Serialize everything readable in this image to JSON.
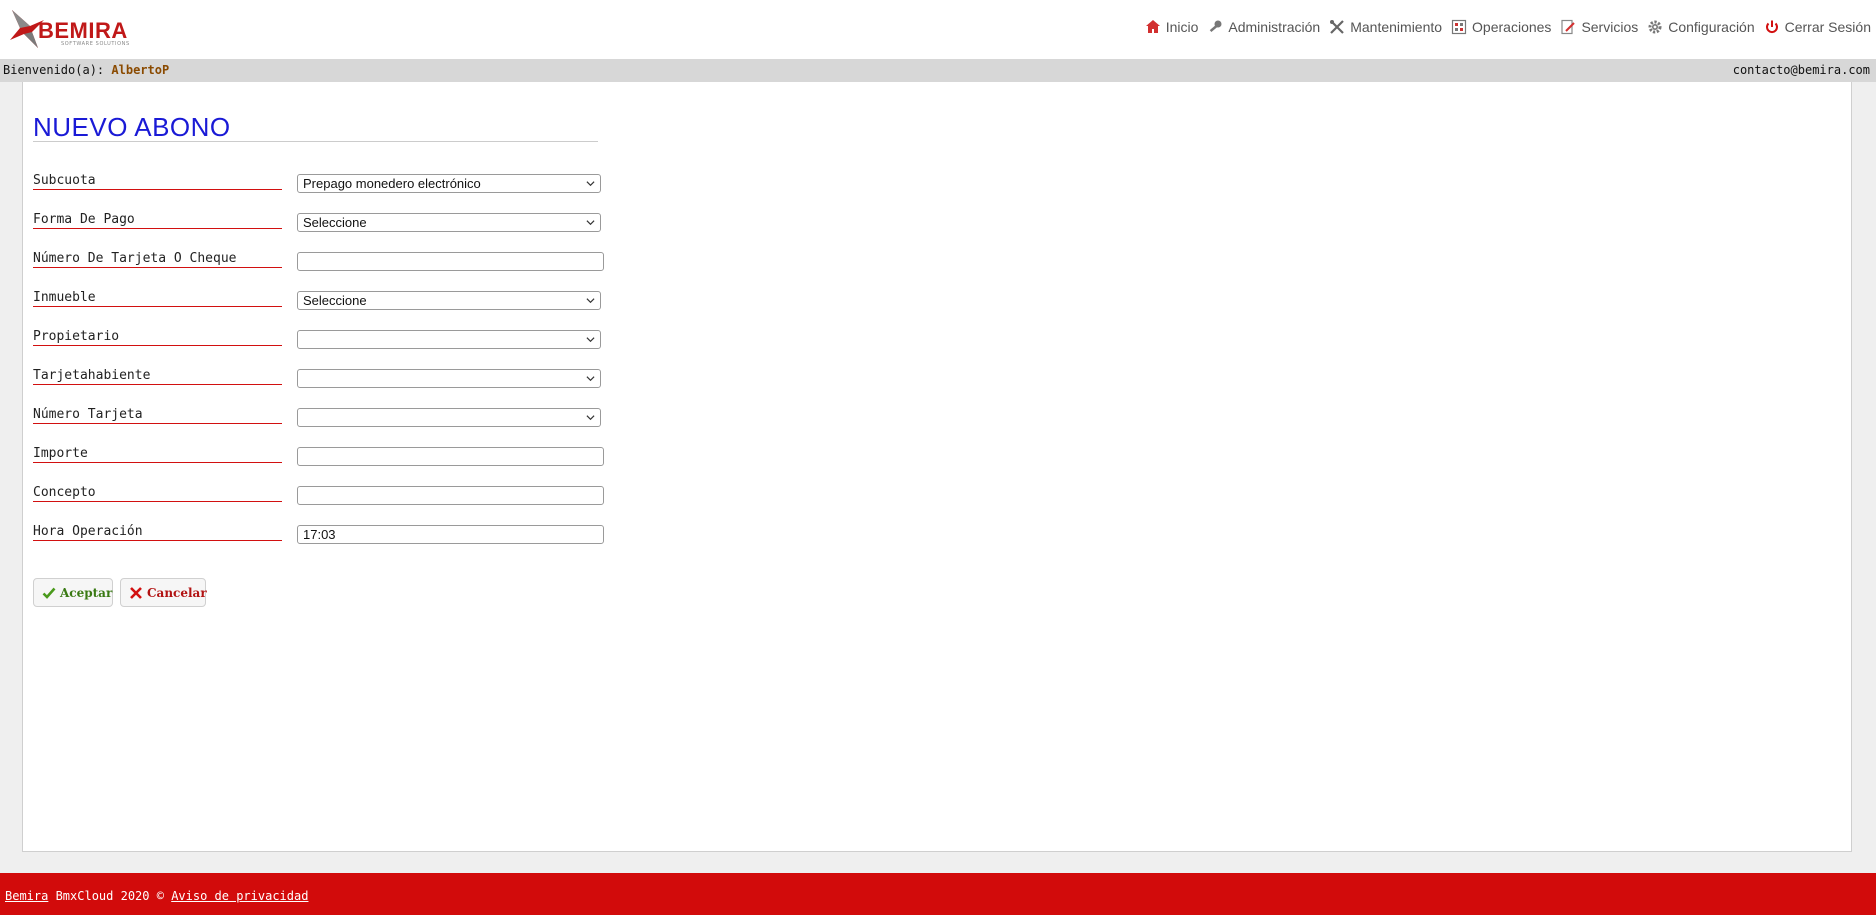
{
  "header": {
    "logo_text": "BEMIRA",
    "logo_tagline": "software solutions",
    "nav": [
      {
        "label": "Inicio",
        "icon": "home-icon"
      },
      {
        "label": "Administración",
        "icon": "key-icon"
      },
      {
        "label": "Mantenimiento",
        "icon": "tools-icon"
      },
      {
        "label": "Operaciones",
        "icon": "calculator-icon"
      },
      {
        "label": "Servicios",
        "icon": "document-pencil-icon"
      },
      {
        "label": "Configuración",
        "icon": "gear-icon"
      },
      {
        "label": "Cerrar Sesión",
        "icon": "power-icon"
      }
    ]
  },
  "welcome_bar": {
    "greeting": "Bienvenido(a):",
    "user": "AlbertoP",
    "email": "contacto@bemira.com"
  },
  "form": {
    "title": "NUEVO ABONO",
    "fields": [
      {
        "label": "Subcuota",
        "type": "select",
        "value": "Prepago monedero electrónico"
      },
      {
        "label": "Forma De Pago",
        "type": "select",
        "value": "Seleccione"
      },
      {
        "label": "Número De Tarjeta O Cheque",
        "type": "input",
        "value": ""
      },
      {
        "label": "Inmueble",
        "type": "select",
        "value": "Seleccione"
      },
      {
        "label": "Propietario",
        "type": "select",
        "value": ""
      },
      {
        "label": "Tarjetahabiente",
        "type": "select",
        "value": ""
      },
      {
        "label": "Número Tarjeta",
        "type": "select",
        "value": ""
      },
      {
        "label": "Importe",
        "type": "input",
        "value": ""
      },
      {
        "label": "Concepto",
        "type": "input",
        "value": ""
      },
      {
        "label": "Hora Operación",
        "type": "input",
        "value": "17:03"
      }
    ],
    "accept_label": "Aceptar",
    "cancel_label": "Cancelar"
  },
  "footer": {
    "brand_link": "Bemira",
    "text": " BmxCloud 2020 © ",
    "privacy_link": "Aviso de privacidad"
  },
  "colors": {
    "title": "#1a1ad6",
    "label_underline": "#d21010",
    "footer_bg": "#d20b0b",
    "accept": "#3a7a14",
    "cancel": "#b21212"
  }
}
